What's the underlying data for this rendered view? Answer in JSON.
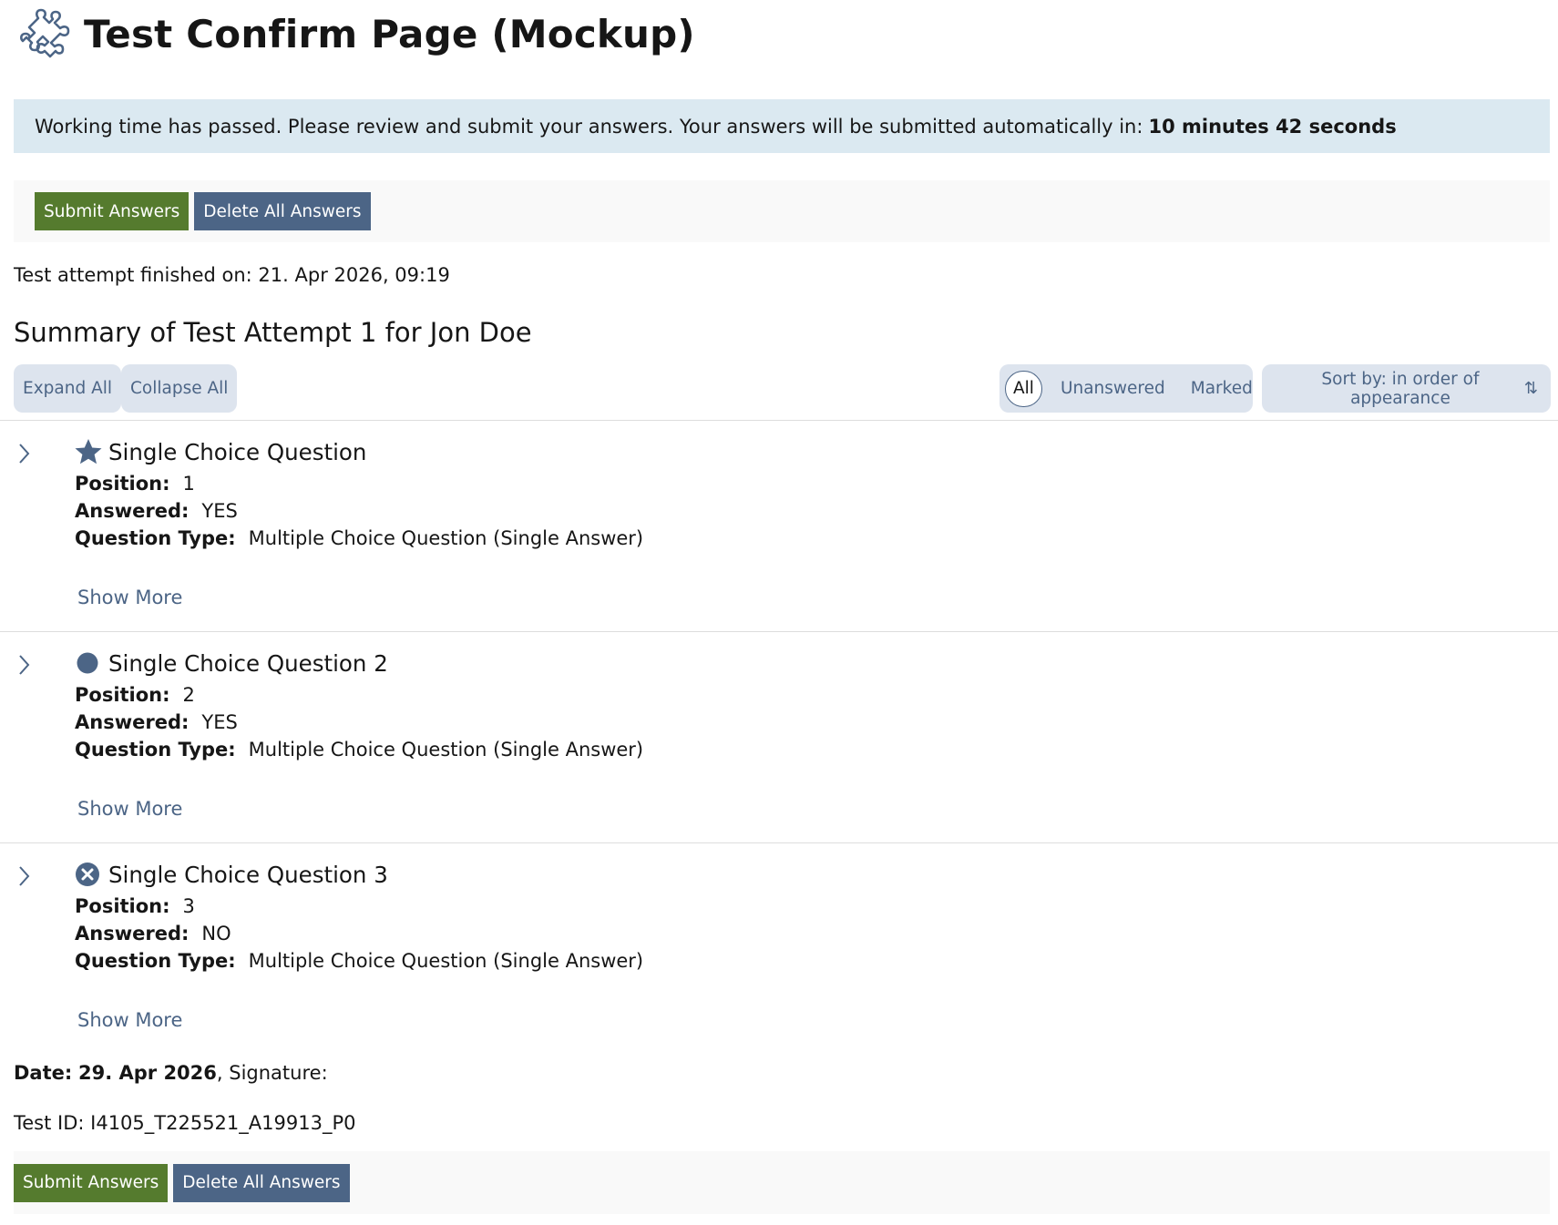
{
  "header": {
    "title": "Test Confirm Page (Mockup)",
    "icon": "puzzle-icon"
  },
  "notice": {
    "text": "Working time has passed. Please review and submit your answers. Your answers will be submitted automatically in:",
    "countdown": "10 minutes 42 seconds"
  },
  "toolbar": {
    "submit_label": "Submit Answers",
    "delete_label": "Delete All Answers"
  },
  "finished_on": "Test attempt finished on: 21. Apr 2026, 09:19",
  "summary_title": "Summary of Test Attempt 1 for Jon Doe",
  "view_controls": {
    "expand_all": "Expand All",
    "collapse_all": "Collapse All"
  },
  "filters": {
    "all": "All",
    "unanswered": "Unanswered",
    "marked": "Marked",
    "active": "All"
  },
  "sort": {
    "label": "Sort by: in order of appearance",
    "icon": "sort-arrows-icon"
  },
  "labels": {
    "position": "Position:",
    "answered": "Answered:",
    "question_type": "Question Type:",
    "show_more": "Show More"
  },
  "questions": [
    {
      "title": "Single Choice Question",
      "position": "1",
      "answered": "YES",
      "type": "Multiple Choice Question (Single Answer)",
      "status_icon": "star-icon"
    },
    {
      "title": "Single Choice Question 2",
      "position": "2",
      "answered": "YES",
      "type": "Multiple Choice Question (Single Answer)",
      "status_icon": "circle-icon"
    },
    {
      "title": "Single Choice Question 3",
      "position": "3",
      "answered": "NO",
      "type": "Multiple Choice Question (Single Answer)",
      "status_icon": "x-circle-icon"
    }
  ],
  "footer": {
    "date_label": "Date:",
    "date_value": "29. Apr 2026",
    "signature": ", Signature:",
    "test_id": "Test ID: I4105_T225521_A19913_P0"
  },
  "colors": {
    "primary": "#557b2e",
    "secondary": "#4c6586",
    "info_bg": "#dbe9f1",
    "control_bg": "#dde4ee"
  }
}
